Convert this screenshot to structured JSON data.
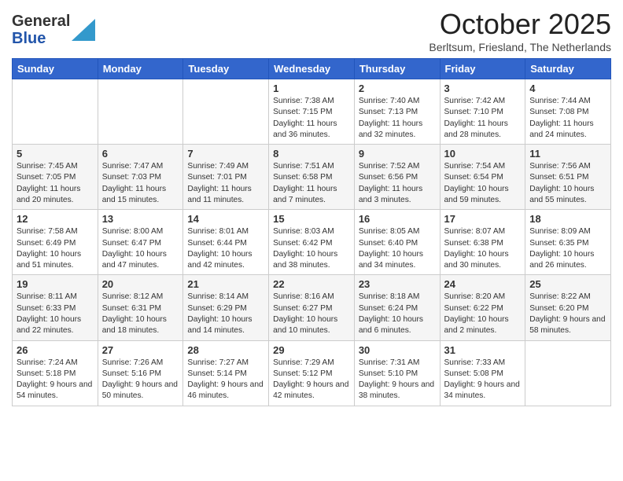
{
  "header": {
    "logo_general": "General",
    "logo_blue": "Blue",
    "month_title": "October 2025",
    "location": "Berltsum, Friesland, The Netherlands"
  },
  "days_of_week": [
    "Sunday",
    "Monday",
    "Tuesday",
    "Wednesday",
    "Thursday",
    "Friday",
    "Saturday"
  ],
  "weeks": [
    [
      {
        "num": "",
        "info": ""
      },
      {
        "num": "",
        "info": ""
      },
      {
        "num": "",
        "info": ""
      },
      {
        "num": "1",
        "info": "Sunrise: 7:38 AM\nSunset: 7:15 PM\nDaylight: 11 hours and 36 minutes."
      },
      {
        "num": "2",
        "info": "Sunrise: 7:40 AM\nSunset: 7:13 PM\nDaylight: 11 hours and 32 minutes."
      },
      {
        "num": "3",
        "info": "Sunrise: 7:42 AM\nSunset: 7:10 PM\nDaylight: 11 hours and 28 minutes."
      },
      {
        "num": "4",
        "info": "Sunrise: 7:44 AM\nSunset: 7:08 PM\nDaylight: 11 hours and 24 minutes."
      }
    ],
    [
      {
        "num": "5",
        "info": "Sunrise: 7:45 AM\nSunset: 7:05 PM\nDaylight: 11 hours and 20 minutes."
      },
      {
        "num": "6",
        "info": "Sunrise: 7:47 AM\nSunset: 7:03 PM\nDaylight: 11 hours and 15 minutes."
      },
      {
        "num": "7",
        "info": "Sunrise: 7:49 AM\nSunset: 7:01 PM\nDaylight: 11 hours and 11 minutes."
      },
      {
        "num": "8",
        "info": "Sunrise: 7:51 AM\nSunset: 6:58 PM\nDaylight: 11 hours and 7 minutes."
      },
      {
        "num": "9",
        "info": "Sunrise: 7:52 AM\nSunset: 6:56 PM\nDaylight: 11 hours and 3 minutes."
      },
      {
        "num": "10",
        "info": "Sunrise: 7:54 AM\nSunset: 6:54 PM\nDaylight: 10 hours and 59 minutes."
      },
      {
        "num": "11",
        "info": "Sunrise: 7:56 AM\nSunset: 6:51 PM\nDaylight: 10 hours and 55 minutes."
      }
    ],
    [
      {
        "num": "12",
        "info": "Sunrise: 7:58 AM\nSunset: 6:49 PM\nDaylight: 10 hours and 51 minutes."
      },
      {
        "num": "13",
        "info": "Sunrise: 8:00 AM\nSunset: 6:47 PM\nDaylight: 10 hours and 47 minutes."
      },
      {
        "num": "14",
        "info": "Sunrise: 8:01 AM\nSunset: 6:44 PM\nDaylight: 10 hours and 42 minutes."
      },
      {
        "num": "15",
        "info": "Sunrise: 8:03 AM\nSunset: 6:42 PM\nDaylight: 10 hours and 38 minutes."
      },
      {
        "num": "16",
        "info": "Sunrise: 8:05 AM\nSunset: 6:40 PM\nDaylight: 10 hours and 34 minutes."
      },
      {
        "num": "17",
        "info": "Sunrise: 8:07 AM\nSunset: 6:38 PM\nDaylight: 10 hours and 30 minutes."
      },
      {
        "num": "18",
        "info": "Sunrise: 8:09 AM\nSunset: 6:35 PM\nDaylight: 10 hours and 26 minutes."
      }
    ],
    [
      {
        "num": "19",
        "info": "Sunrise: 8:11 AM\nSunset: 6:33 PM\nDaylight: 10 hours and 22 minutes."
      },
      {
        "num": "20",
        "info": "Sunrise: 8:12 AM\nSunset: 6:31 PM\nDaylight: 10 hours and 18 minutes."
      },
      {
        "num": "21",
        "info": "Sunrise: 8:14 AM\nSunset: 6:29 PM\nDaylight: 10 hours and 14 minutes."
      },
      {
        "num": "22",
        "info": "Sunrise: 8:16 AM\nSunset: 6:27 PM\nDaylight: 10 hours and 10 minutes."
      },
      {
        "num": "23",
        "info": "Sunrise: 8:18 AM\nSunset: 6:24 PM\nDaylight: 10 hours and 6 minutes."
      },
      {
        "num": "24",
        "info": "Sunrise: 8:20 AM\nSunset: 6:22 PM\nDaylight: 10 hours and 2 minutes."
      },
      {
        "num": "25",
        "info": "Sunrise: 8:22 AM\nSunset: 6:20 PM\nDaylight: 9 hours and 58 minutes."
      }
    ],
    [
      {
        "num": "26",
        "info": "Sunrise: 7:24 AM\nSunset: 5:18 PM\nDaylight: 9 hours and 54 minutes."
      },
      {
        "num": "27",
        "info": "Sunrise: 7:26 AM\nSunset: 5:16 PM\nDaylight: 9 hours and 50 minutes."
      },
      {
        "num": "28",
        "info": "Sunrise: 7:27 AM\nSunset: 5:14 PM\nDaylight: 9 hours and 46 minutes."
      },
      {
        "num": "29",
        "info": "Sunrise: 7:29 AM\nSunset: 5:12 PM\nDaylight: 9 hours and 42 minutes."
      },
      {
        "num": "30",
        "info": "Sunrise: 7:31 AM\nSunset: 5:10 PM\nDaylight: 9 hours and 38 minutes."
      },
      {
        "num": "31",
        "info": "Sunrise: 7:33 AM\nSunset: 5:08 PM\nDaylight: 9 hours and 34 minutes."
      },
      {
        "num": "",
        "info": ""
      }
    ]
  ]
}
